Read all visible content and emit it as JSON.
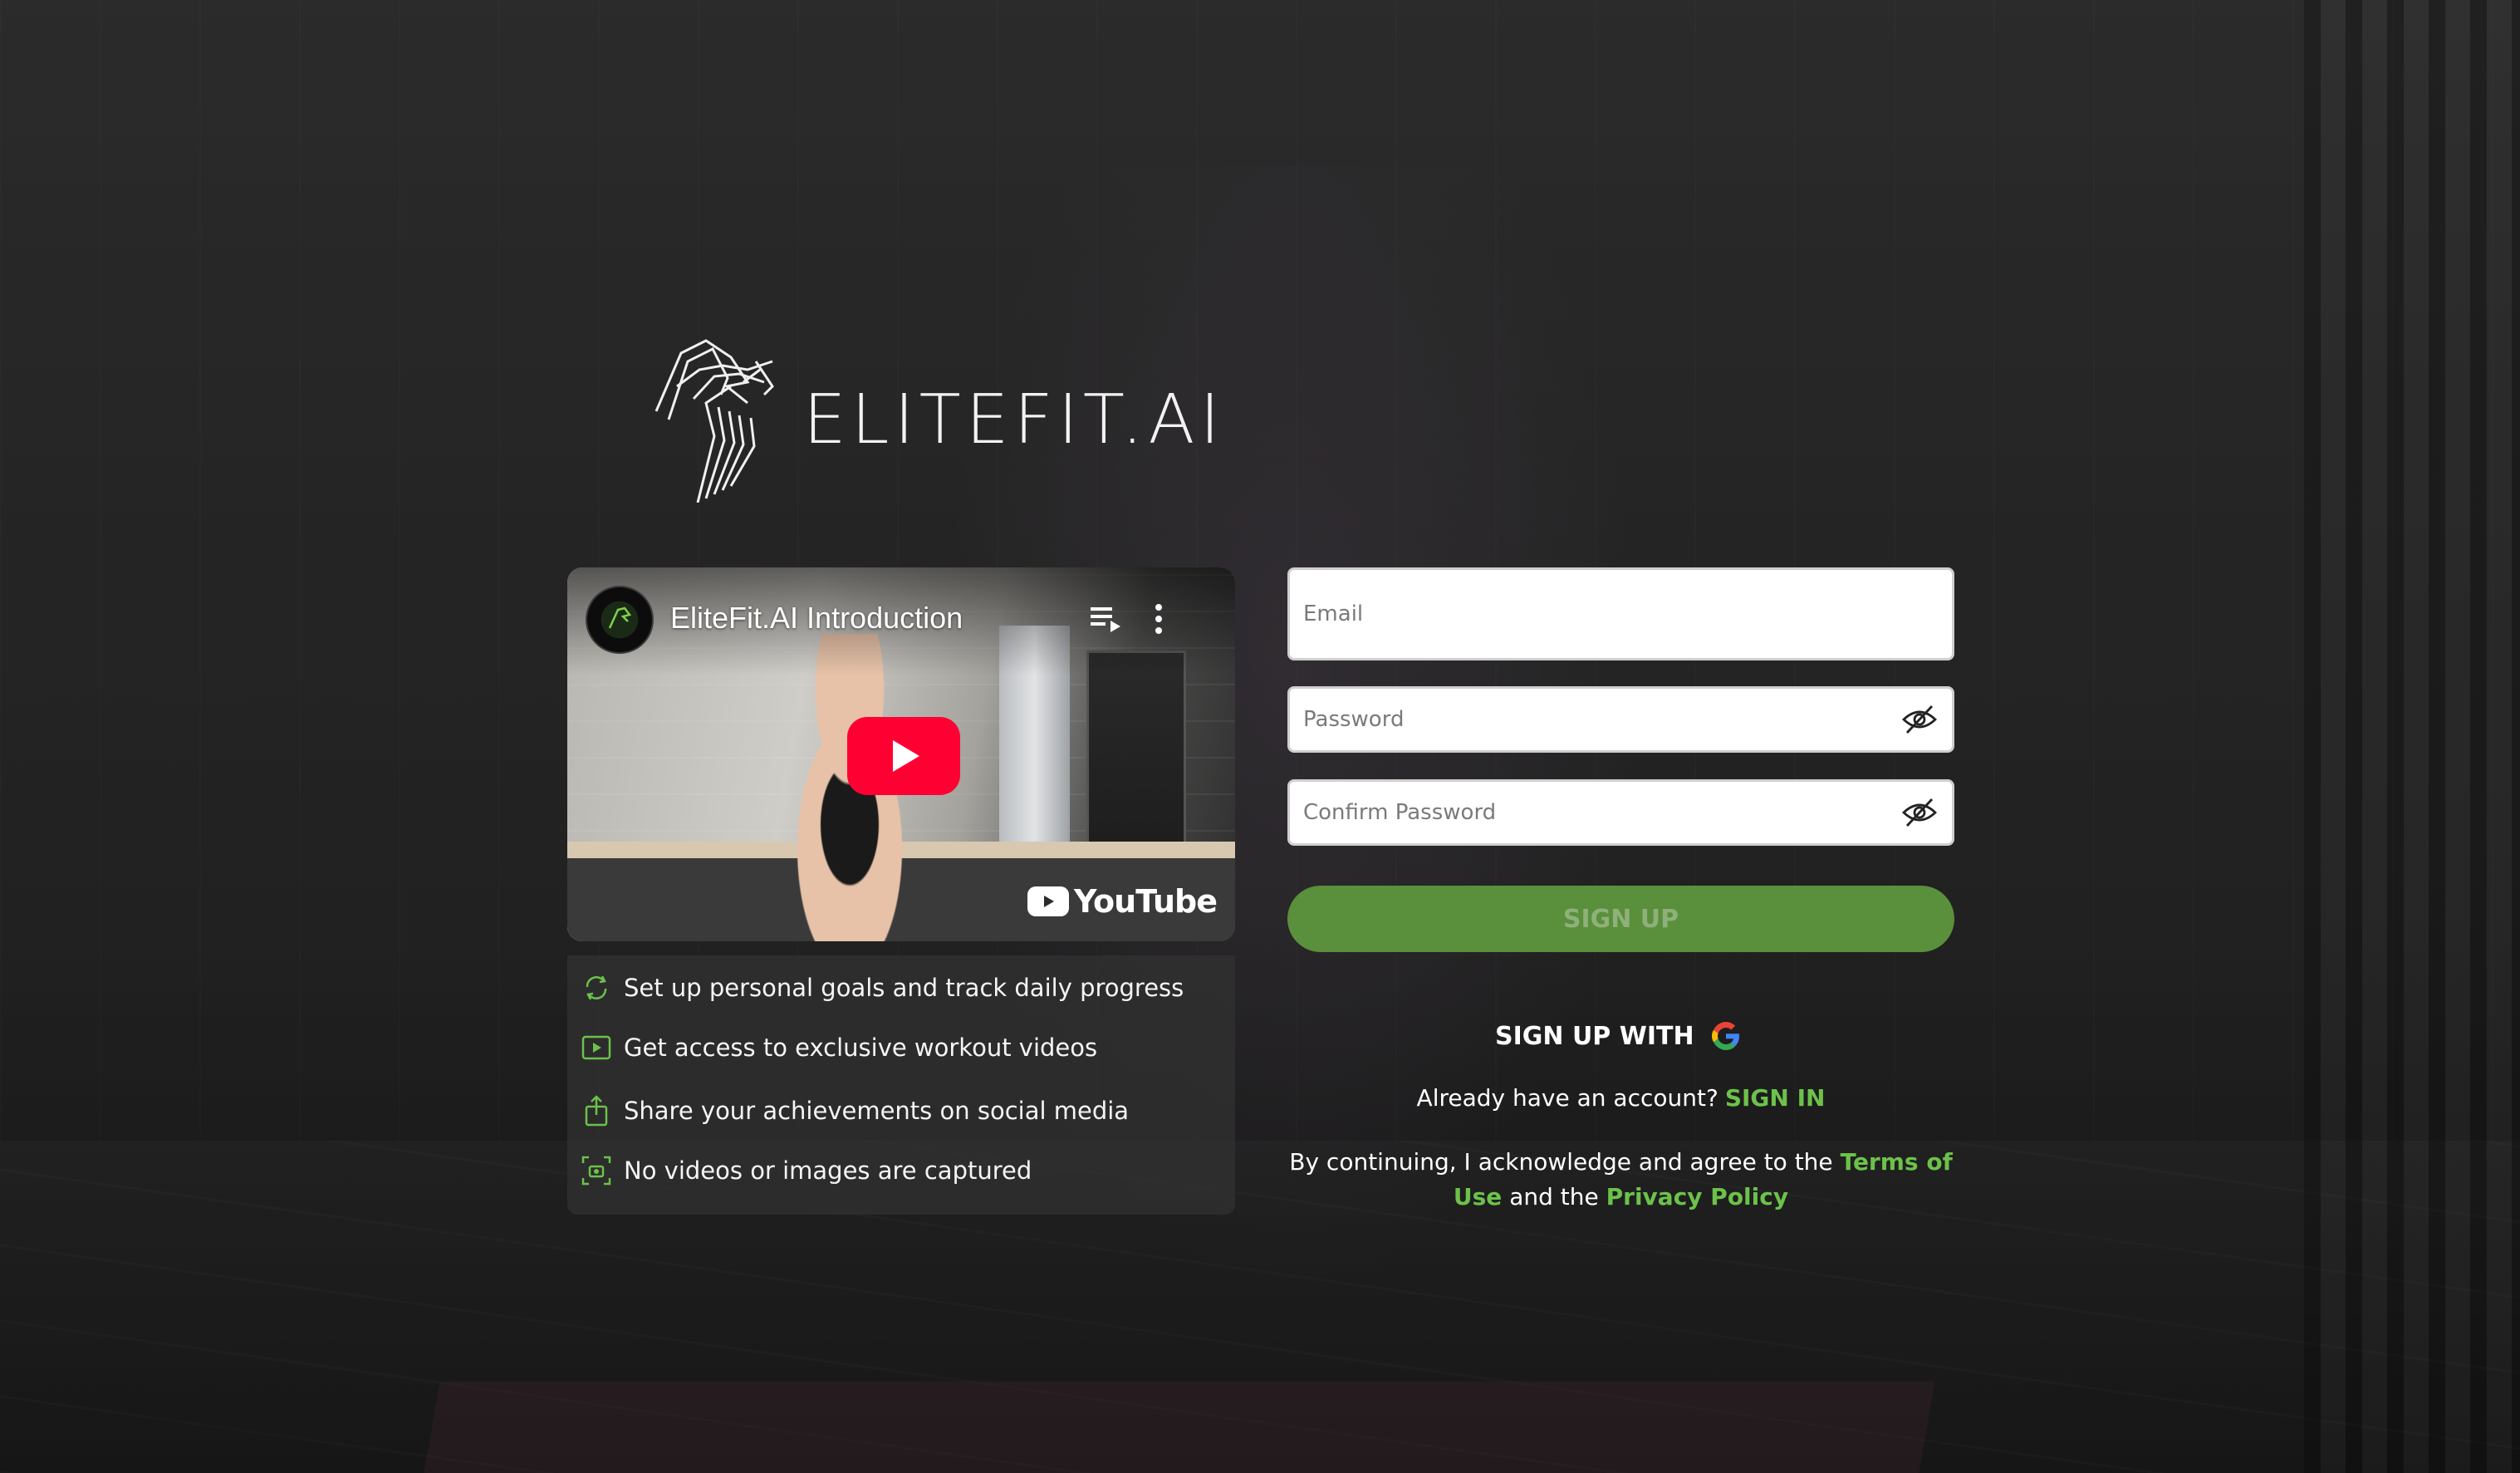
{
  "brand": {
    "name": "ELITEFIT.AI",
    "accent": "#6cc24a",
    "button_color": "#5a8f3b"
  },
  "video": {
    "title": "EliteFit.AI Introduction",
    "platform": "YouTube",
    "icons": [
      "channel-avatar",
      "playlist-icon",
      "more-vert-icon",
      "play-icon",
      "youtube-logo"
    ]
  },
  "features": [
    {
      "icon": "refresh-icon",
      "text": "Set up personal goals and track daily progress"
    },
    {
      "icon": "video-play-icon",
      "text": "Get access to exclusive workout videos"
    },
    {
      "icon": "share-icon",
      "text": "Share your achievements on social media"
    },
    {
      "icon": "camera-off-icon",
      "text": "No videos or images are captured"
    }
  ],
  "form": {
    "email_placeholder": "Email",
    "password_placeholder": "Password",
    "confirm_password_placeholder": "Confirm Password",
    "submit_label": "SIGN UP",
    "google_label": "SIGN UP WITH",
    "have_account_text": "Already have an account?",
    "signin_link": "SIGN IN",
    "terms_prefix": "By continuing, I acknowledge and agree to the",
    "terms_link": "Terms of Use",
    "terms_and": "and the",
    "privacy_link": "Privacy Policy"
  }
}
